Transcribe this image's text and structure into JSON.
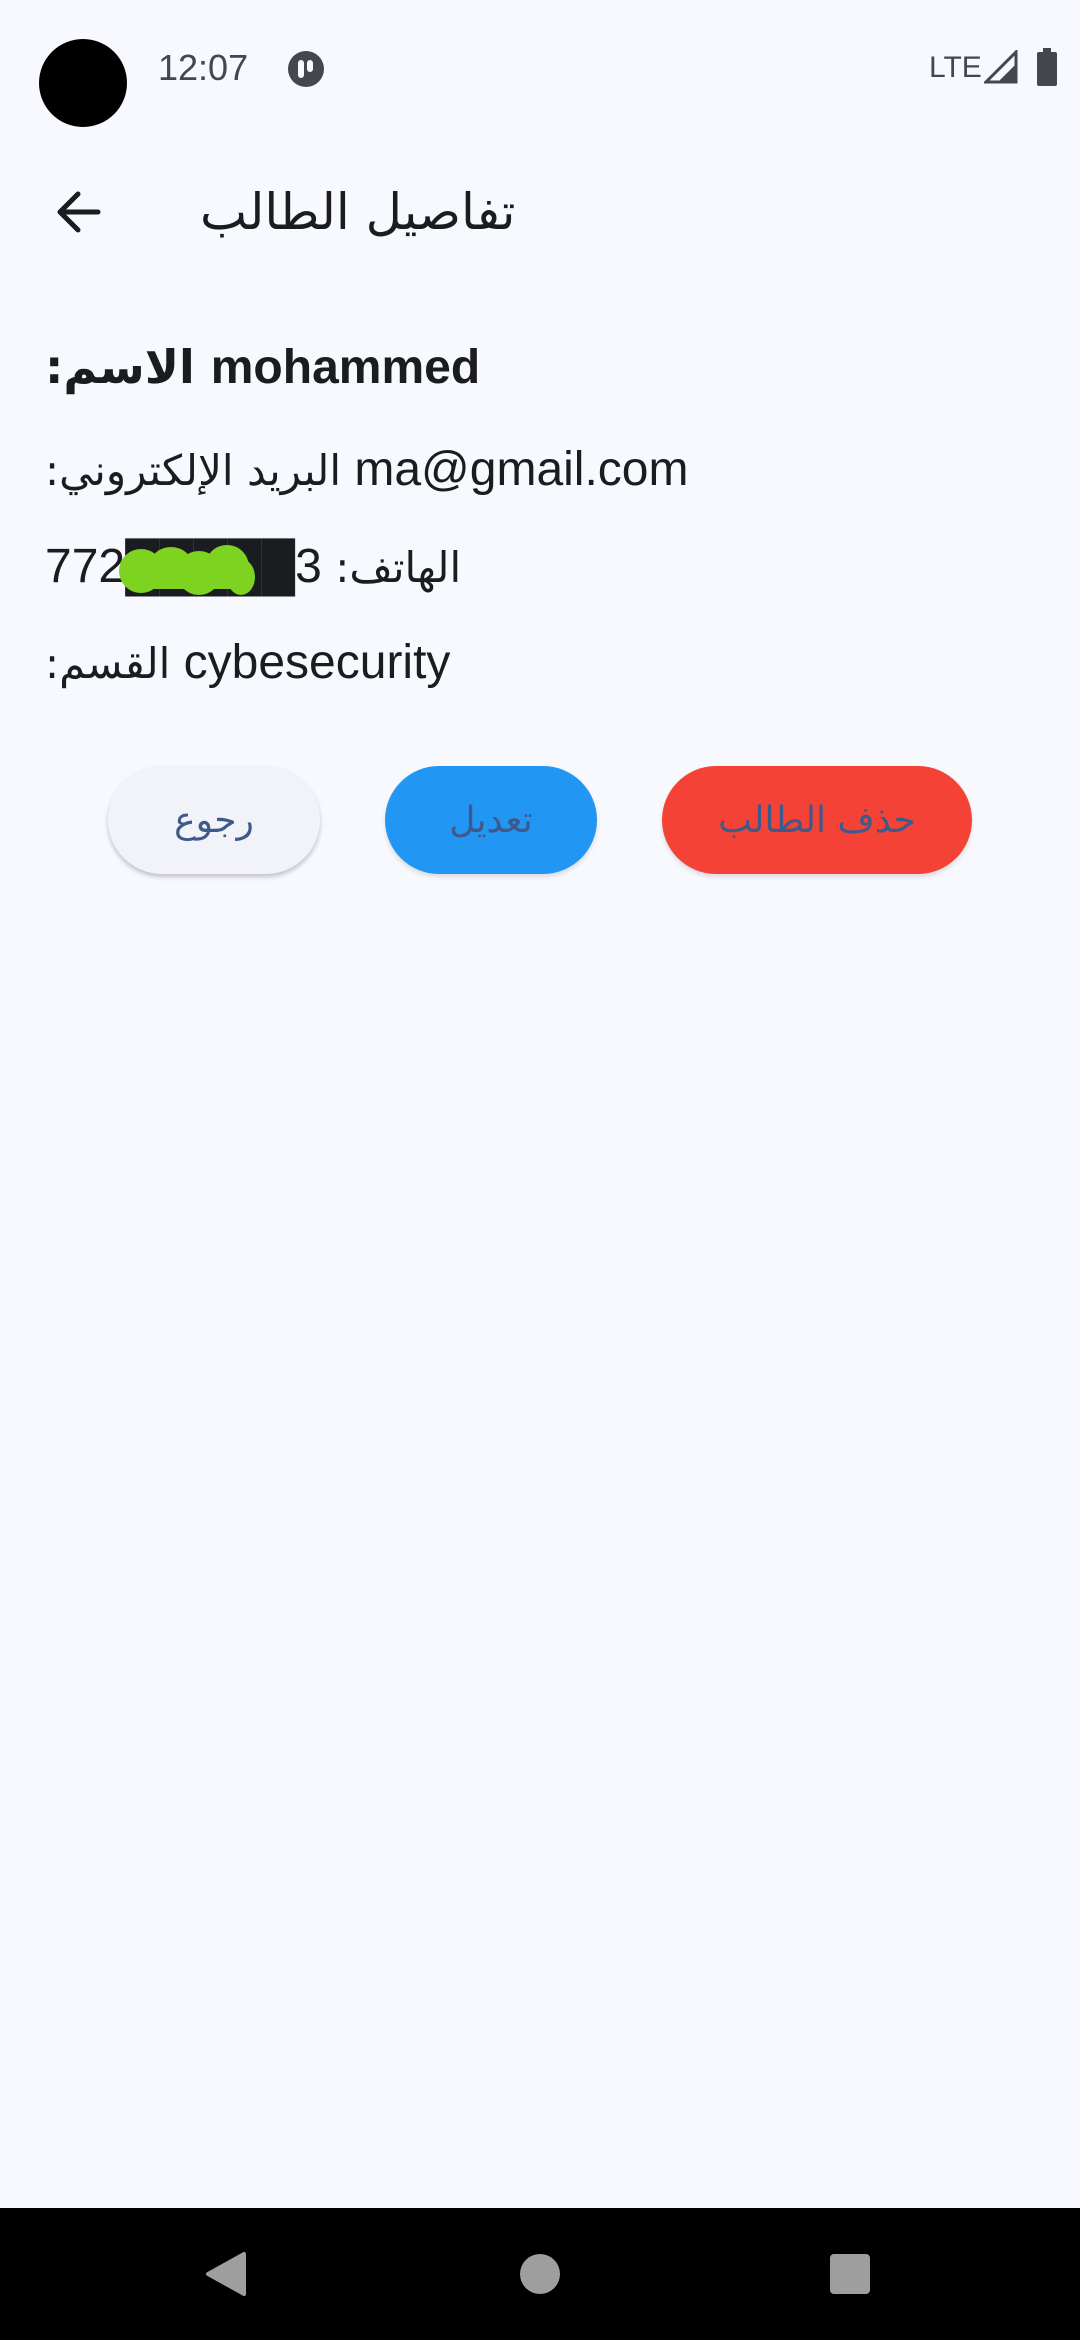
{
  "status_bar": {
    "time": "12:07",
    "network": "LTE",
    "icons": [
      "app-notification-icon",
      "cellular-signal-icon",
      "battery-icon"
    ]
  },
  "app_bar": {
    "title": "تفاصيل الطالب",
    "back_icon": "arrow-back-icon"
  },
  "student": {
    "name_label": "الاسم:",
    "name_value": "mohammed",
    "email_label": "البريد الإلكتروني:",
    "email_value": "ma@gmail.com",
    "phone_label": "الهاتف:",
    "phone_value": "772█████3",
    "department_label": "القسم:",
    "department_value": "cybesecurity"
  },
  "actions": {
    "back_label": "رجوع",
    "edit_label": "تعديل",
    "delete_label": "حذف الطالب"
  },
  "colors": {
    "background": "#f7f9fe",
    "edit_button": "#2196f3",
    "delete_button": "#f44336",
    "back_button": "#f1f3f8",
    "button_text": "#3f5a8a",
    "redaction": "#7ed321"
  },
  "nav_bar": {
    "icons": [
      "nav-back-icon",
      "nav-home-icon",
      "nav-recents-icon"
    ]
  }
}
